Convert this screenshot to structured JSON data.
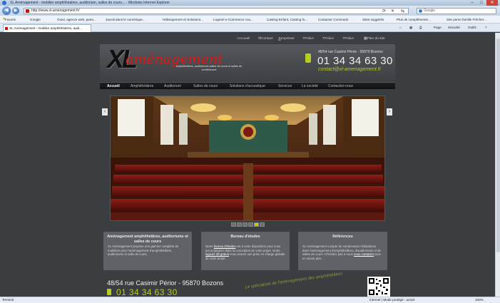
{
  "browser": {
    "title": "XL Aménagement - mobilier amphithéatres, auditorium, salles de cours... - Windows Internet Explorer",
    "url": "http://www.xl-amenagement.fr/",
    "search_placeholder": "Google",
    "favorites_label": "Favoris",
    "favorites": [
      "Google",
      "Oxiut, agence web, parto...",
      "Javoiii dans le numérique...",
      "Hébergement et Solutions...",
      "Logiciel e-Commerce cou...",
      "Casting Enfant, Casting fu...",
      "Contacter Commodo",
      "Sites suggérés",
      "Plus de compléments...",
      "Site perso famille Frécher..."
    ],
    "tab_title": "XL Aménagement - mobilier amphithéatres, audi...",
    "commands": [
      "Page",
      "Sécurité",
      "Outils"
    ],
    "status_left": "Terminé",
    "status_zone": "Internet | Mode protégé : activé",
    "zoom": "100%"
  },
  "site": {
    "topnav": [
      "Accueil",
      "Contact",
      "Imprimer",
      "Police",
      "Police",
      "Police",
      "Plan du site"
    ],
    "logo": {
      "mark": "XL",
      "word": "aménagement",
      "tagline": "amphithéâtres, auditoriums salles de cours et salles de conférences"
    },
    "header": {
      "address": "48/54 rue Casimir Périor - 95870 Bozons",
      "phone": "01 34 34 63 30",
      "email": "contact@xl-amenagement.fr"
    },
    "menu": [
      "Accueil",
      "Amphithéâtres",
      "Auditorium",
      "Salles de cours",
      "Solutions d'acoustique",
      "Services",
      "La société",
      "Contactez-nous"
    ],
    "slider_dots": [
      "1",
      "2",
      "3",
      "4",
      "5",
      "6"
    ],
    "boxes": [
      {
        "title": "Aménagement amphithéâtres, auditoriums et salles de cours",
        "text": "XL Aménagement propose une gamme complète de mobiliers pour l'aménagement d'amphithéâtres, auditoriums et salle de cours."
      },
      {
        "title": "Bureau d'études",
        "text_before": "Notre ",
        "link1": "bureau d'études",
        "text_mid": " est à votre disposition pour vous accompagner dans la conception de votre projet. Notre ",
        "link2": "logiciel 3D gratuit",
        "text_after": " vous assure une prise en charge globale de votre projet."
      },
      {
        "title": "Références",
        "text_before": "XL Aménagement compte de nombreuses réalisations dans l'aménagement d'amphithéâtres, d'auditoriums et de salles de cours. N'hésitez pas à nous ",
        "link1": "nous contacter",
        "text_after": " pour en savoir plus."
      }
    ],
    "footer": {
      "address": "48/54 rue Casimir Périor - 95870 Bozons",
      "phone": "01 34 34 63 30",
      "slogan": "Le spécialiste de l'aménagement des amphithéâtres"
    }
  },
  "colors": {
    "accent": "#b7cc1e",
    "logo_red": "#d71a1a",
    "page_bg": "#3b3e41"
  }
}
